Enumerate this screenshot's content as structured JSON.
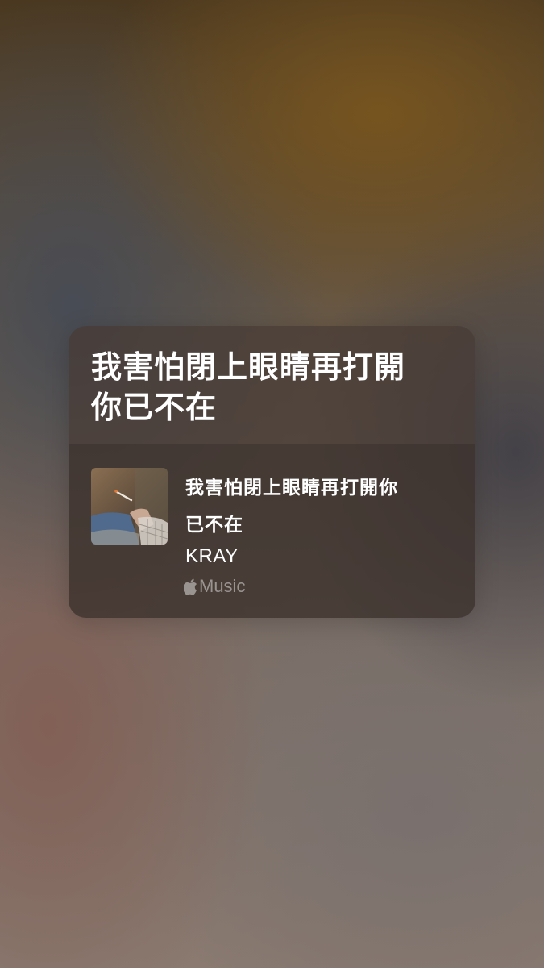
{
  "lyric_card": {
    "lyric_line_1": "我害怕閉上眼睛再打開",
    "lyric_line_2": "你已不在"
  },
  "track": {
    "title_line_1": "我害怕閉上眼睛再打開你",
    "title_line_2": "已不在",
    "artist": "KRAY",
    "album_art_icon": "album-art"
  },
  "service": {
    "logo_icon": "apple-icon",
    "logo_text": "Music"
  },
  "colors": {
    "card_background": "#463a34",
    "text_primary": "#ffffff",
    "text_muted": "#a8a09a"
  }
}
